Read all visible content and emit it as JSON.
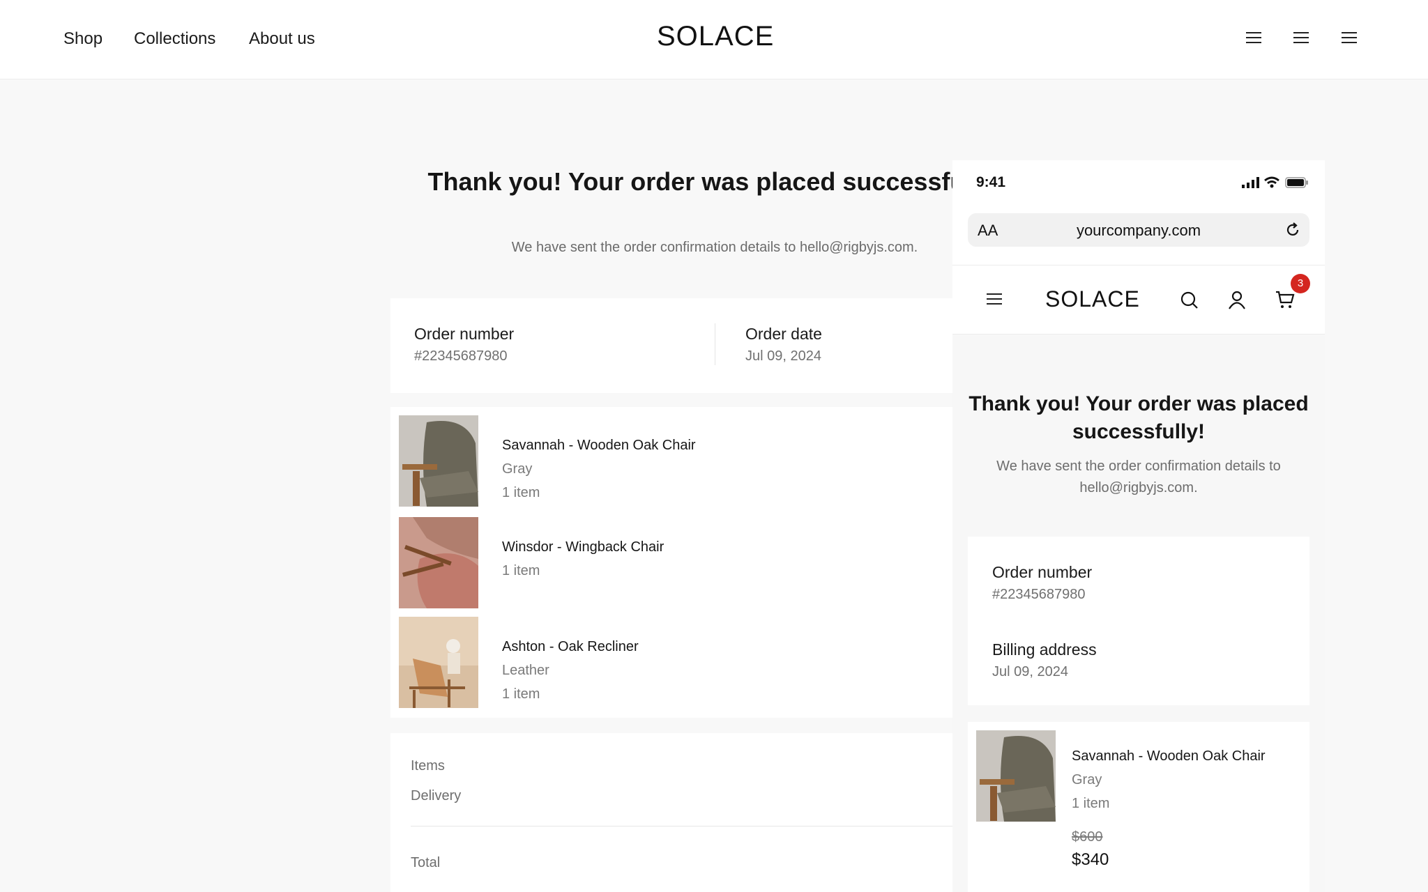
{
  "nav": {
    "links": [
      "Shop",
      "Collections",
      "About us"
    ],
    "brand": "SOLACE"
  },
  "hero": {
    "title": "Thank you! Your order was placed successfully!",
    "subtitle": "We have sent the order confirmation details to hello@rigbyjs.com."
  },
  "order": {
    "number_label": "Order number",
    "number_value": "#22345687980",
    "date_label": "Order date",
    "date_value": "Jul 09, 2024"
  },
  "items": [
    {
      "name": "Savannah - Wooden Oak Chair",
      "variant": "Gray",
      "qty": "1 item"
    },
    {
      "name": "Winsdor - Wingback Chair",
      "variant": "",
      "qty": "1 item"
    },
    {
      "name": "Ashton - Oak Recliner",
      "variant": "Leather",
      "qty": "1 item"
    }
  ],
  "summary": {
    "items_label": "Items",
    "delivery_label": "Delivery",
    "total_label": "Total"
  },
  "mobile": {
    "time": "9:41",
    "aa": "AA",
    "url": "yourcompany.com",
    "brand": "SOLACE",
    "cart_count": "3",
    "title": "Thank you! Your order was placed successfully!",
    "subtitle": "We have sent the order confirmation details to hello@rigbyjs.com.",
    "order_label": "Order number",
    "order_value": "#22345687980",
    "billing_label": "Billing address",
    "billing_value": "Jul 09, 2024",
    "item": {
      "name": "Savannah - Wooden Oak Chair",
      "variant": "Gray",
      "qty": "1 item",
      "price_old": "$600",
      "price_new": "$340"
    }
  },
  "icons": [
    "menu-icon",
    "search-icon",
    "user-icon",
    "cart-icon",
    "signal-icon",
    "wifi-icon",
    "battery-icon",
    "reload-icon"
  ],
  "colors": {
    "badge": "#d4261f",
    "page_bg": "#f8f8f8"
  }
}
